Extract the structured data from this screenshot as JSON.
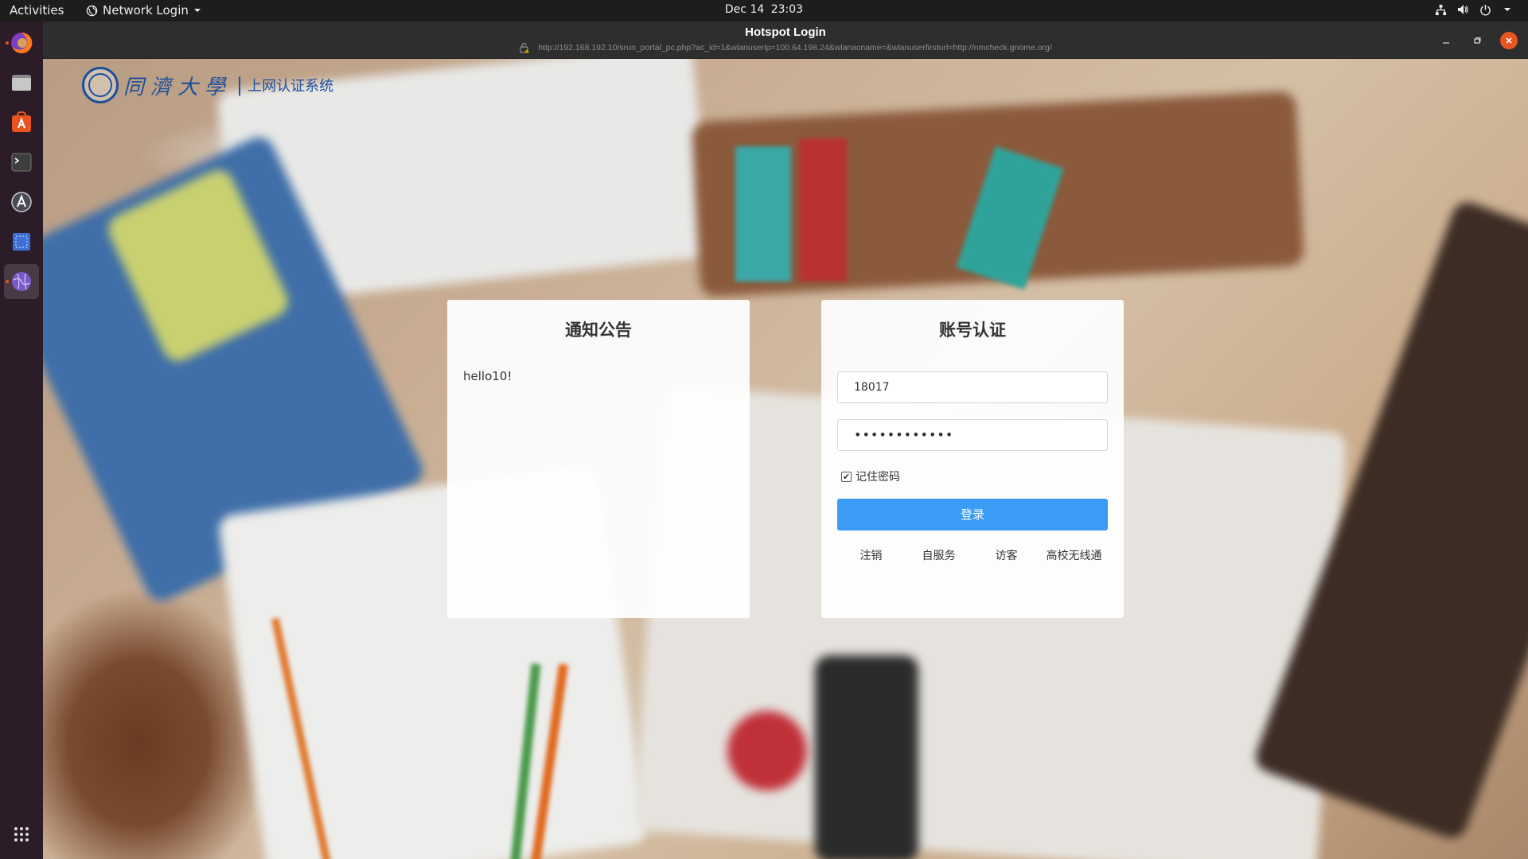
{
  "topbar": {
    "activities": "Activities",
    "app_menu": "Network Login",
    "date": "Dec 14",
    "time": "23:03"
  },
  "window": {
    "title": "Hotspot Login",
    "url": "http://192.168.192.10/srun_portal_pc.php?ac_id=1&wlanuserip=100.64.198.24&wlanacname=&wlanuserfirsturl=http://nmcheck.gnome.org/"
  },
  "logo": {
    "university": "同濟大學",
    "separator": "|",
    "system_name": "上网认证系统"
  },
  "notice": {
    "title": "通知公告",
    "text": "hello10!"
  },
  "auth": {
    "title": "账号认证",
    "username": "18017",
    "password": "••••••••••••",
    "remember_label": "记住密码",
    "remember_checked": true,
    "login_label": "登录",
    "links": [
      "注销",
      "自服务",
      "访客",
      "高校无线通"
    ]
  },
  "colors": {
    "accent": "#3b9cf5",
    "logo_blue": "#1e4f9c",
    "close": "#e95420"
  }
}
